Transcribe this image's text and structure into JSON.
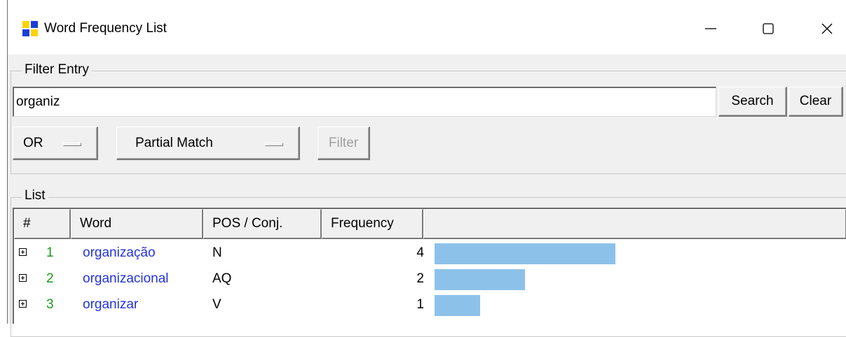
{
  "window": {
    "title": "Word Frequency List",
    "icon": "app-grid-icon",
    "minimize_icon": "minimize-icon",
    "maximize_icon": "maximize-icon",
    "close_icon": "close-icon"
  },
  "filter_entry": {
    "legend": "Filter Entry",
    "search_value": "organiz",
    "search_label": "Search",
    "clear_label": "Clear",
    "logic_value": "OR",
    "match_value": "Partial Match",
    "filter_label": "Filter"
  },
  "list": {
    "legend": "List",
    "columns": [
      "#",
      "Word",
      "POS / Conj.",
      "Frequency",
      ""
    ],
    "rows": [
      {
        "num": "1",
        "word": "organização",
        "pos": "N",
        "frequency": "4",
        "bar_fraction": 1.0
      },
      {
        "num": "2",
        "word": "organizacional",
        "pos": "AQ",
        "frequency": "2",
        "bar_fraction": 0.5
      },
      {
        "num": "3",
        "word": "organizar",
        "pos": "V",
        "frequency": "1",
        "bar_fraction": 0.25
      }
    ]
  },
  "colors": {
    "bar": "#8cc2ea",
    "number": "#1a9a1a",
    "word": "#2233dd",
    "icon_blue": "#1a3fd6",
    "icon_yellow": "#ffd400"
  }
}
